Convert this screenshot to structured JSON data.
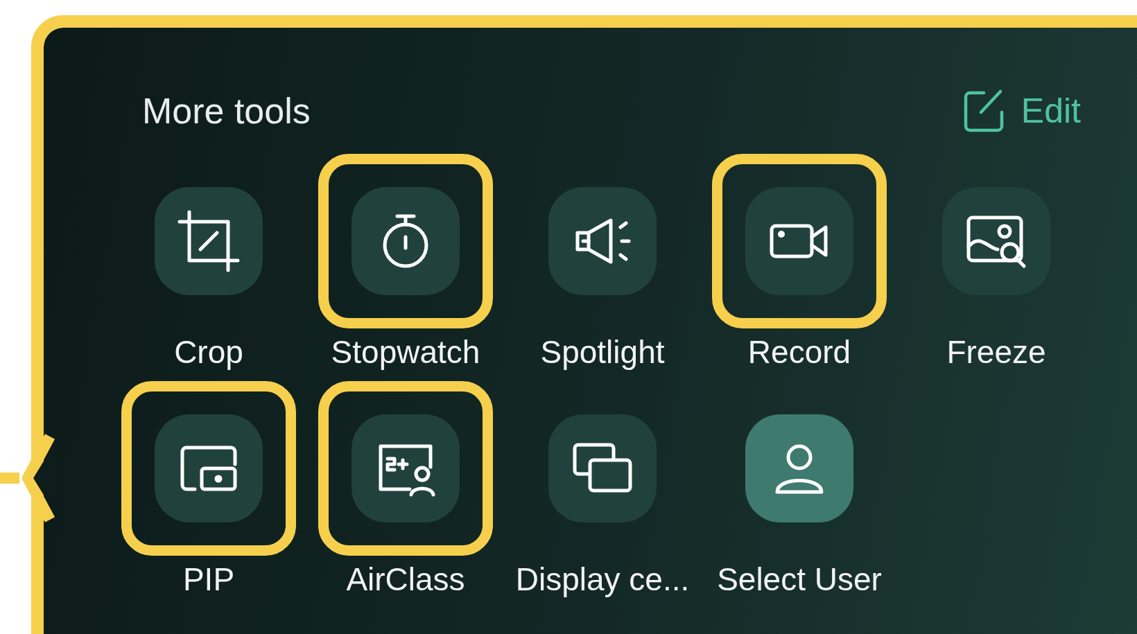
{
  "panel": {
    "title": "More tools",
    "edit_label": "Edit",
    "highlighted": true
  },
  "tools": [
    {
      "label": "Crop",
      "highlighted": false,
      "selected": false
    },
    {
      "label": "Stopwatch",
      "highlighted": true,
      "selected": false
    },
    {
      "label": "Spotlight",
      "highlighted": false,
      "selected": false
    },
    {
      "label": "Record",
      "highlighted": true,
      "selected": false
    },
    {
      "label": "Freeze",
      "highlighted": false,
      "selected": false
    },
    {
      "label": "PIP",
      "highlighted": true,
      "selected": false
    },
    {
      "label": "AirClass",
      "highlighted": true,
      "selected": false
    },
    {
      "label": "Display ce...",
      "highlighted": false,
      "selected": false
    },
    {
      "label": "Select User",
      "highlighted": false,
      "selected": true
    }
  ]
}
